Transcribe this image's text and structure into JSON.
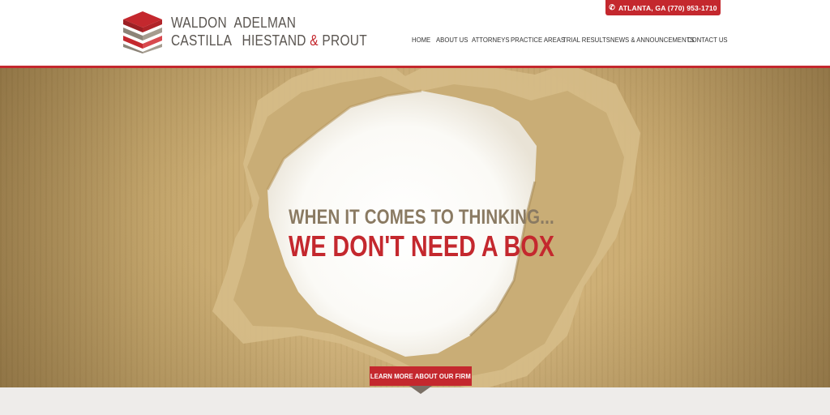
{
  "brand": {
    "line1_word1": "WALDON",
    "line1_word2": "ADELMAN",
    "line2_word1": "CASTILLA",
    "line2_word2": "HIESTAND",
    "line2_amp": "&",
    "line2_word3": "PROUT",
    "logo_icon": "stacked-blocks-logo-icon"
  },
  "phone": {
    "icon": "phone-icon",
    "text": "ATLANTA, GA (770) 953-1710"
  },
  "nav": {
    "items": [
      {
        "label": "HOME"
      },
      {
        "label": "ABOUT US"
      },
      {
        "label": "ATTORNEYS"
      },
      {
        "label": "PRACTICE AREAS"
      },
      {
        "label": "TRIAL RESULTS"
      },
      {
        "label": "NEWS & ANNOUNCEMENTS"
      },
      {
        "label": "CONTACT US"
      }
    ]
  },
  "hero": {
    "line1": "WHEN IT COMES TO THINKING...",
    "line2": "WE DON'T NEED A BOX",
    "cta_label": "LEARN MORE ABOUT OUR FIRM"
  },
  "colors": {
    "accent": "#c4282e",
    "cardboard": "#d2b47b",
    "text_dark": "#333333"
  }
}
